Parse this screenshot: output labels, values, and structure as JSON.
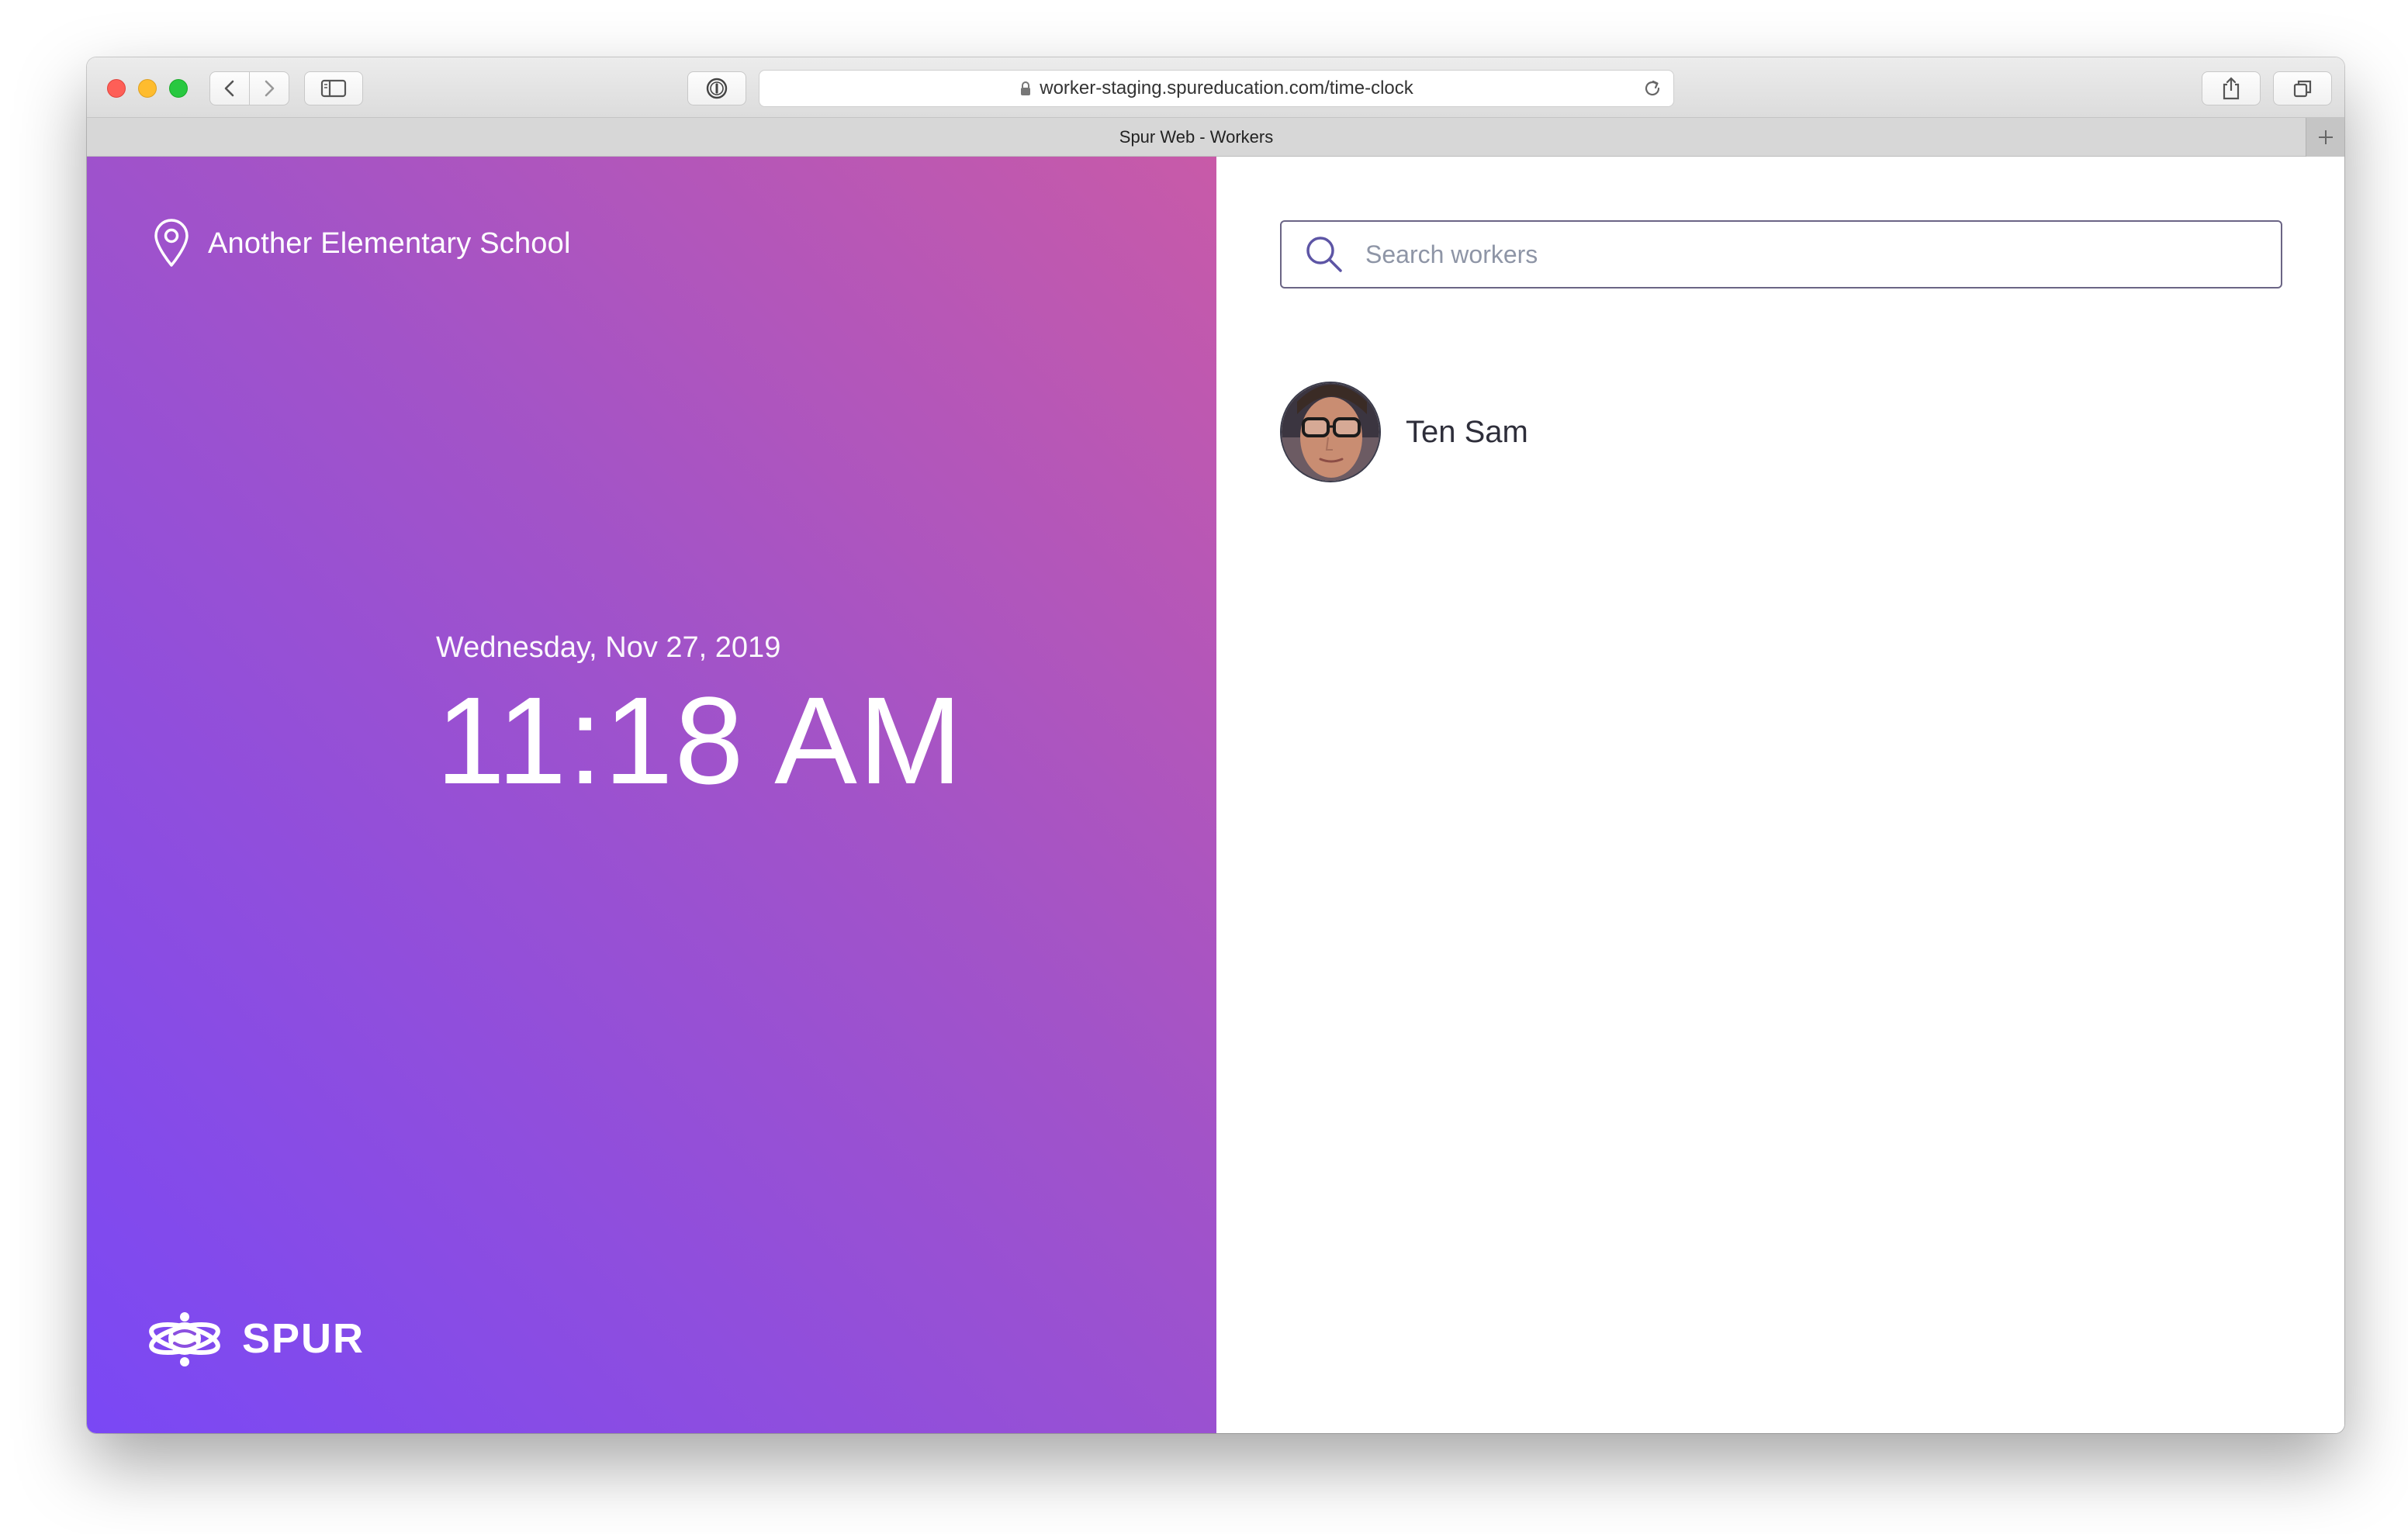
{
  "browser": {
    "url": "worker-staging.spureducation.com/time-clock",
    "tab_title": "Spur Web - Workers",
    "icons": [
      "back-icon",
      "forward-icon",
      "sidebar-icon",
      "password-icon",
      "lock-icon",
      "reload-icon",
      "share-icon",
      "tabs-icon",
      "new-tab-icon"
    ]
  },
  "left_panel": {
    "location_name": "Another Elementary School",
    "date": "Wednesday, Nov 27, 2019",
    "time": "11:18 AM",
    "brand_name": "SPUR",
    "gradient_colors": [
      "#c85aa8",
      "#a253c8",
      "#7a48f5"
    ]
  },
  "search": {
    "placeholder": "Search workers",
    "value": ""
  },
  "workers": [
    {
      "name": "Ten Sam"
    }
  ]
}
